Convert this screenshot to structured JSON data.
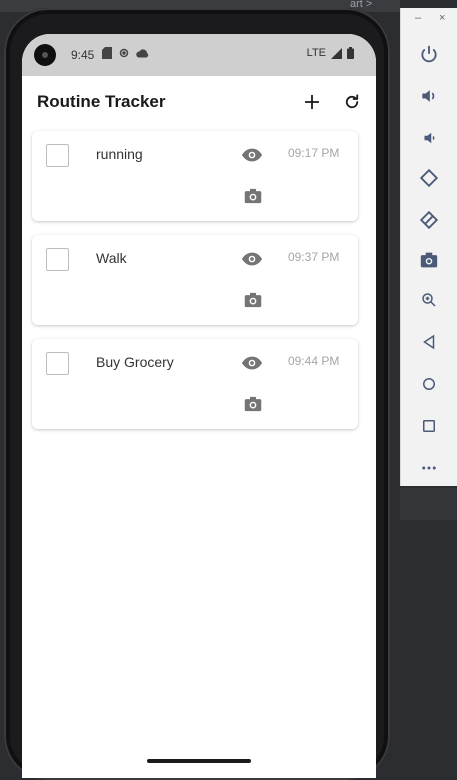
{
  "ide": {
    "top_fragment": "art >"
  },
  "emulator_panel": {
    "window_controls": {
      "minimize": "–",
      "close": "×"
    },
    "buttons": [
      {
        "name": "power-icon"
      },
      {
        "name": "volume-up-icon"
      },
      {
        "name": "volume-down-icon"
      },
      {
        "name": "rotate-left-icon"
      },
      {
        "name": "rotate-right-icon"
      },
      {
        "name": "screenshot-camera-icon"
      },
      {
        "name": "zoom-icon"
      },
      {
        "name": "back-icon"
      },
      {
        "name": "home-icon"
      },
      {
        "name": "overview-icon"
      },
      {
        "name": "more-icon"
      }
    ]
  },
  "status_bar": {
    "time": "9:45",
    "network": "LTE",
    "icons": [
      "sd-card-icon",
      "gear-icon",
      "cloud-icon"
    ]
  },
  "app_bar": {
    "title": "Routine Tracker",
    "actions": [
      {
        "name": "add-icon"
      },
      {
        "name": "refresh-icon"
      }
    ]
  },
  "tasks": [
    {
      "name": "running",
      "time": "09:17 PM",
      "checked": false
    },
    {
      "name": "Walk",
      "time": "09:37 PM",
      "checked": false
    },
    {
      "name": "Buy Grocery",
      "time": "09:44 PM",
      "checked": false
    }
  ],
  "colors": {
    "icon_grey": "#757575",
    "panel_icon": "#4a5a78",
    "status_bar_bg": "#cfcfcf"
  }
}
